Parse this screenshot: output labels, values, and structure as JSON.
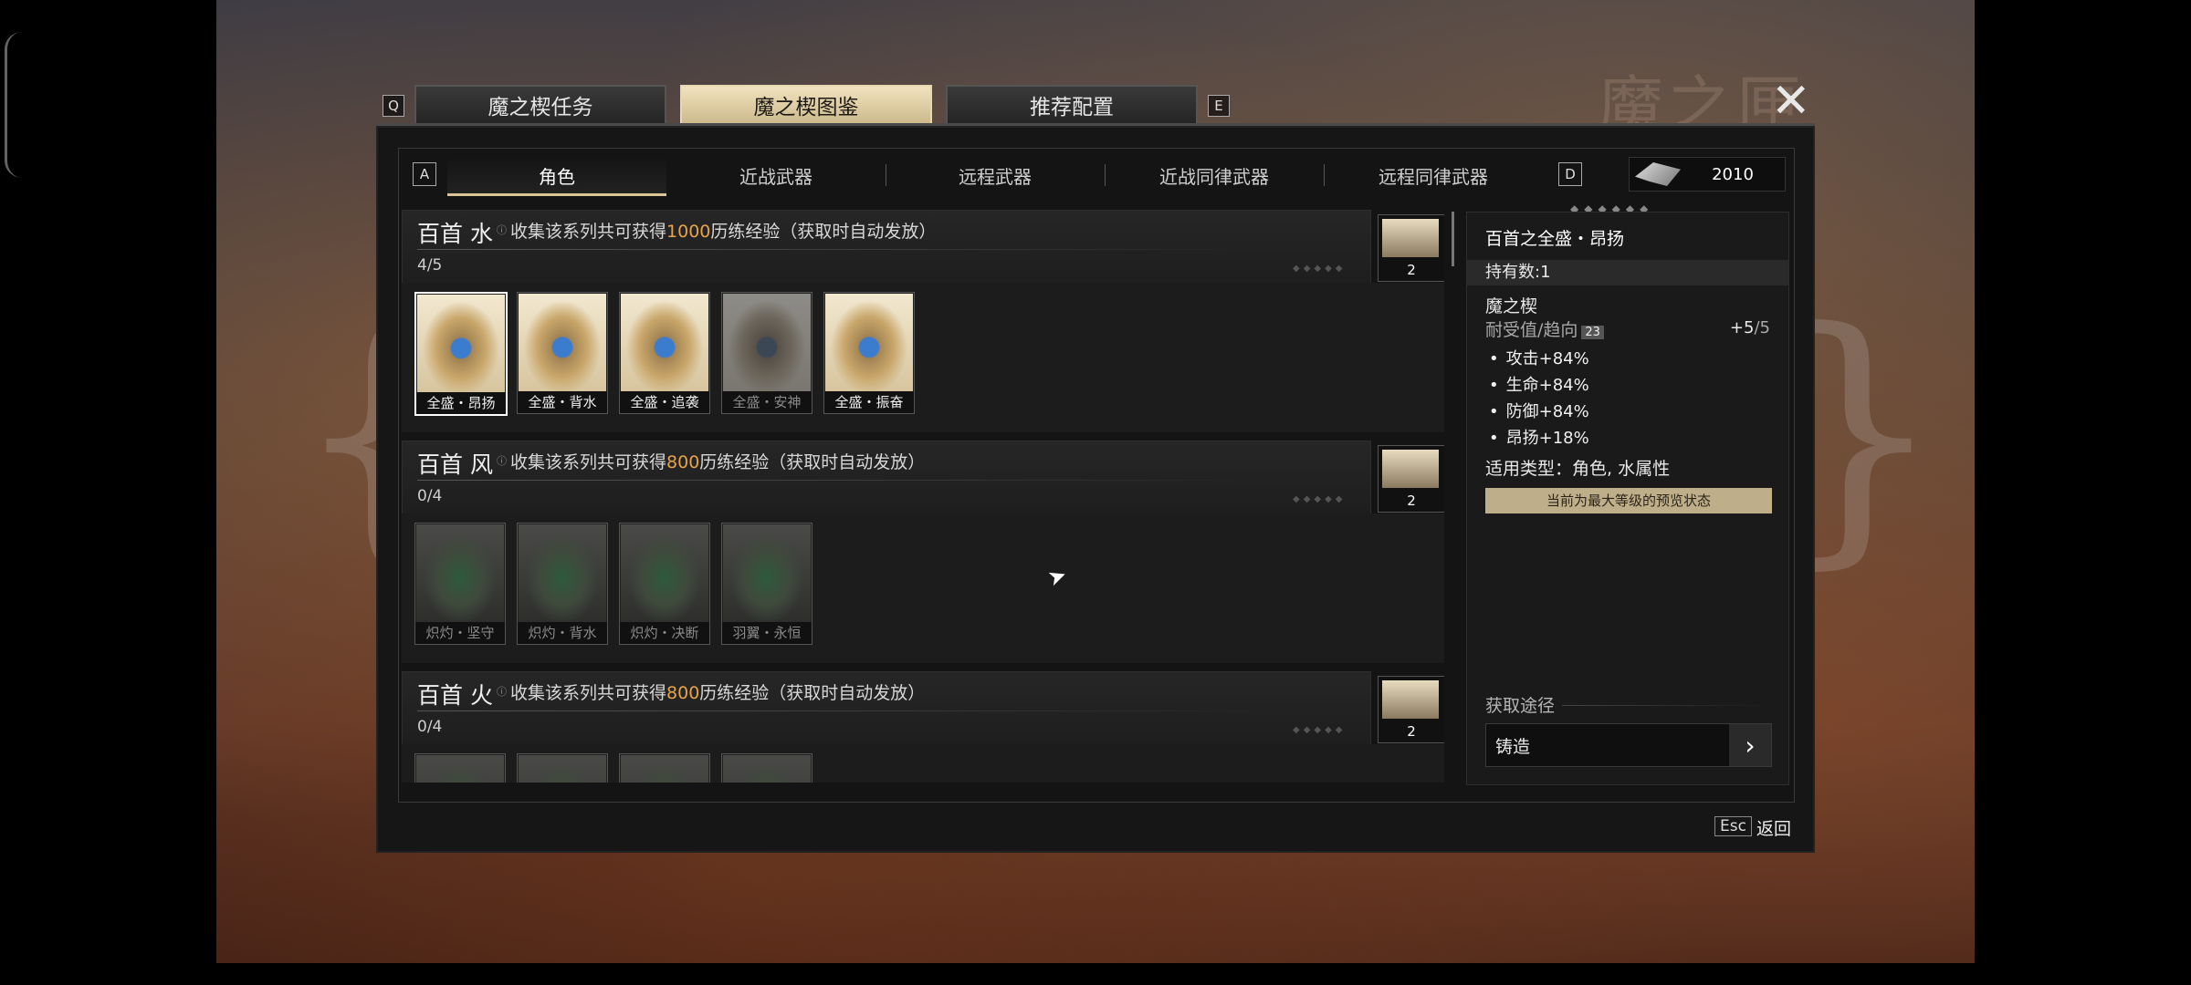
{
  "top_tabs": {
    "key_left": "Q",
    "key_right": "E",
    "items": [
      {
        "label": "魔之楔任务"
      },
      {
        "label": "魔之楔图鉴"
      },
      {
        "label": "推荐配置"
      }
    ]
  },
  "background_mark": "魔之匣",
  "categories": {
    "key_left": "A",
    "key_right": "D",
    "items": [
      {
        "label": "角色"
      },
      {
        "label": "近战武器"
      },
      {
        "label": "远程武器"
      },
      {
        "label": "近战同律武器"
      },
      {
        "label": "远程同律武器"
      }
    ]
  },
  "currency": {
    "value": "2010",
    "icon": "wedge-currency-icon"
  },
  "series": [
    {
      "name": "百首 水",
      "sup": "ⓘ",
      "desc_pre": "收集该系列共可获得",
      "exp": "1000",
      "desc_post": "历练经验（获取时自动发放）",
      "progress": "4/5",
      "reward_count": "2",
      "cards": [
        {
          "label": "全盛・昂扬"
        },
        {
          "label": "全盛・背水"
        },
        {
          "label": "全盛・追袭"
        },
        {
          "label": "全盛・安神"
        },
        {
          "label": "全盛・振奋"
        }
      ]
    },
    {
      "name": "百首 风",
      "sup": "ⓘ",
      "desc_pre": "收集该系列共可获得",
      "exp": "800",
      "desc_post": "历练经验（获取时自动发放）",
      "progress": "0/4",
      "reward_count": "2",
      "cards": [
        {
          "label": "炽灼・坚守"
        },
        {
          "label": "炽灼・背水"
        },
        {
          "label": "炽灼・决断"
        },
        {
          "label": "羽翼・永恒"
        }
      ]
    },
    {
      "name": "百首 火",
      "sup": "ⓘ",
      "desc_pre": "收集该系列共可获得",
      "exp": "800",
      "desc_post": "历练经验（获取时自动发放）",
      "progress": "0/4",
      "reward_count": "2",
      "cards": []
    }
  ],
  "detail": {
    "title": "百首之全盛・昂扬",
    "owned": "持有数:1",
    "group": "魔之楔",
    "tolerance_label": "耐受值/趋向",
    "tolerance_badge": "23",
    "level": "+5",
    "level_max": "/5",
    "stats": [
      "攻击+84%",
      "生命+84%",
      "防御+84%",
      "昂扬+18%"
    ],
    "apply_types": "适用类型：角色, 水属性",
    "note": "当前为最大等级的预览状态",
    "source_title": "获取途径",
    "source_value": "铸造"
  },
  "footer": {
    "esc_key": "Esc",
    "back_label": "返回"
  }
}
